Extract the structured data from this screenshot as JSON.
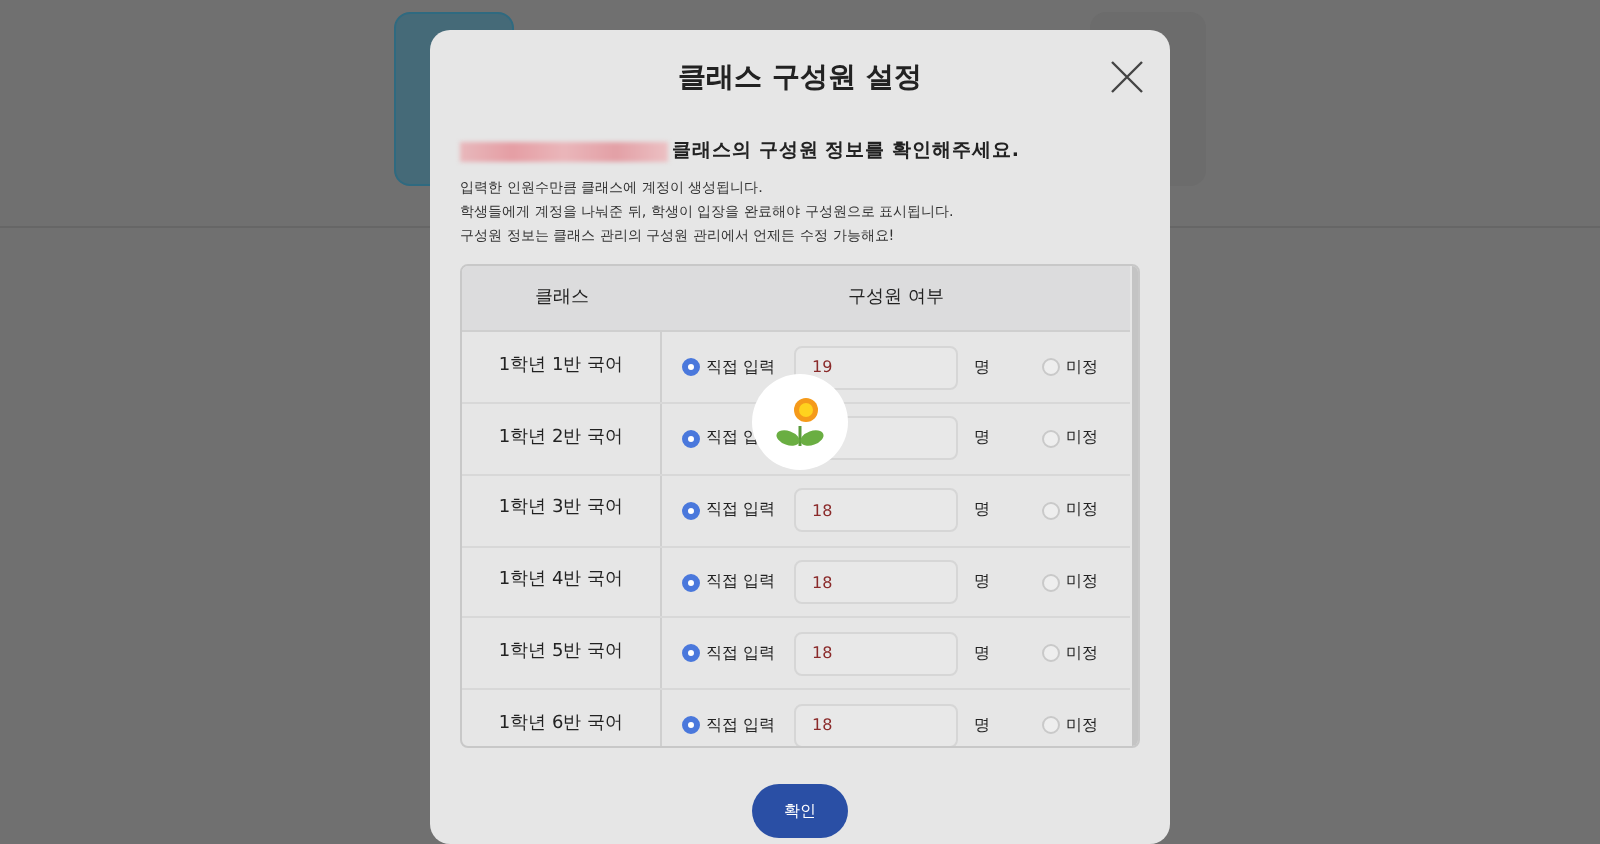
{
  "dialog": {
    "title": "클래스 구성원 설정",
    "notice": "클래스의 구성원 정보를 확인해주세요.",
    "notes": [
      "입력한 인원수만큼 클래스에 계정이 생성됩니다.",
      "학생들에게 계정을 나눠준 뒤, 학생이 입장을 완료해야 구성원으로 표시됩니다.",
      "구성원 정보는 클래스 관리의 구성원 관리에서 언제든 수정 가능해요!"
    ],
    "table": {
      "columns": [
        "클래스",
        "구성원 여부"
      ],
      "rows": [
        {
          "class": "1학년 1반 국어",
          "direct_label": "직접 입력",
          "direct_selected": true,
          "count": "19",
          "unit": "명",
          "undecided_label": "미정",
          "undecided_selected": false
        },
        {
          "class": "1학년 2반 국어",
          "direct_label": "직접 입",
          "direct_selected": true,
          "unit": "명",
          "undecided_label": "미정",
          "undecided_selected": false
        },
        {
          "class": "1학년 3반 국어",
          "direct_label": "직접 입력",
          "direct_selected": true,
          "count": "18",
          "unit": "명",
          "undecided_label": "미정",
          "undecided_selected": false
        },
        {
          "class": "1학년 4반 국어",
          "direct_label": "직접 입력",
          "direct_selected": true,
          "count": "18",
          "unit": "명",
          "undecided_label": "미정",
          "undecided_selected": false
        },
        {
          "class": "1학년 5반 국어",
          "direct_label": "직접 입력",
          "direct_selected": true,
          "count": "18",
          "unit": "명",
          "undecided_label": "미정",
          "undecided_selected": false
        },
        {
          "class": "1학년 6반 국어",
          "direct_label": "직접 입력",
          "direct_selected": true,
          "count": "18",
          "unit": "명",
          "undecided_label": "미정",
          "undecided_selected": false
        }
      ]
    },
    "confirm_button": "확인"
  }
}
